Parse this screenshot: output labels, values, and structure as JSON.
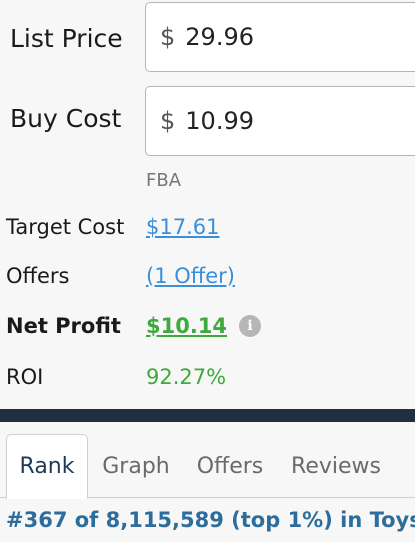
{
  "form": {
    "list_price_label": "List Price",
    "list_price_currency": "$",
    "list_price_value": "29.96",
    "buy_cost_label": "Buy Cost",
    "buy_cost_currency": "$",
    "buy_cost_value": "10.99",
    "fulfillment_label": "FBA"
  },
  "details": {
    "target_cost_label": "Target Cost",
    "target_cost_value": "$17.61",
    "offers_label": "Offers",
    "offers_value": "(1 Offer)",
    "net_profit_label": "Net Profit",
    "net_profit_value": "$10.14",
    "info_icon_glyph": "i",
    "roi_label": "ROI",
    "roi_value": "92.27%"
  },
  "tabs": [
    {
      "label": "Rank",
      "active": true
    },
    {
      "label": "Graph",
      "active": false
    },
    {
      "label": "Offers",
      "active": false
    },
    {
      "label": "Reviews",
      "active": false
    }
  ],
  "rank": {
    "text": "#367 of 8,115,589 (top 1%) in Toys"
  },
  "colors": {
    "link": "#3b8fd9",
    "profit": "#3caa3c",
    "divider": "#1f3040",
    "rank_text": "#2d6d9c"
  }
}
